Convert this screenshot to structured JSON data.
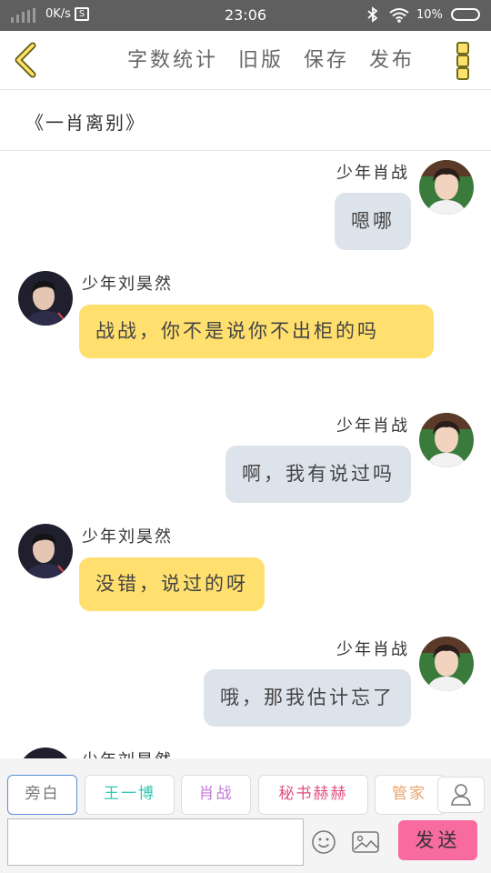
{
  "status_bar": {
    "speed": "0K/s",
    "shot_glyph": "S",
    "time": "23:06",
    "battery": "10%"
  },
  "topbar": {
    "menu": [
      "字数统计",
      "旧版",
      "保存",
      "发布"
    ]
  },
  "story": {
    "title": "《一肖离别》"
  },
  "messages": [
    {
      "side": "right",
      "speaker": "少年肖战",
      "text": "嗯哪"
    },
    {
      "side": "left",
      "speaker": "少年刘昊然",
      "text": "战战，你不是说你不出柜的吗"
    },
    {
      "side": "right",
      "speaker": "少年肖战",
      "text": "啊，我有说过吗"
    },
    {
      "side": "left",
      "speaker": "少年刘昊然",
      "text": "没错，说过的呀"
    },
    {
      "side": "right",
      "speaker": "少年肖战",
      "text": "哦，那我估计忘了"
    },
    {
      "side": "left",
      "speaker": "少年刘昊然",
      "text": ""
    }
  ],
  "roles": [
    {
      "label": "旁白",
      "color": "#777777"
    },
    {
      "label": "王一博",
      "color": "#2fc9b3"
    },
    {
      "label": "肖战",
      "color": "#c27ad6"
    },
    {
      "label": "秘书赫赫",
      "color": "#e0507d"
    },
    {
      "label": "管家",
      "color": "#e9a46a"
    }
  ],
  "input": {
    "send_label": "发送"
  },
  "colors": {
    "bubble_right": "#dde3ea",
    "bubble_left": "#ffdf6e",
    "send_button": "#f86b9f"
  },
  "icons": [
    "back-arrow-icon",
    "more-vertical-icon",
    "user-icon",
    "emoji-icon",
    "image-icon",
    "bluetooth-icon",
    "wifi-icon",
    "battery-icon"
  ]
}
